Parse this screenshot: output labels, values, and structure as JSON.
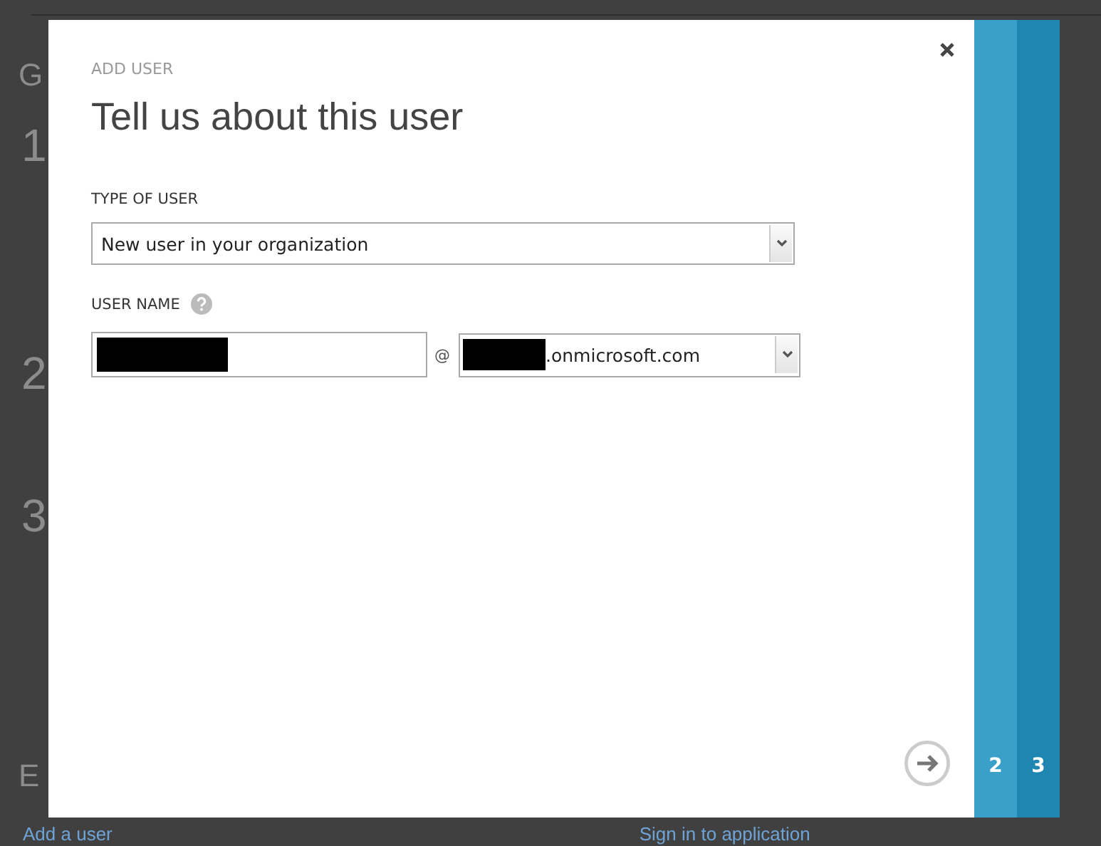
{
  "background": {
    "heading": "G",
    "steps": [
      "1",
      "2",
      "3"
    ],
    "section": "E",
    "links": [
      "Add a user",
      "Sign in to application"
    ]
  },
  "dialog": {
    "caption": "ADD USER",
    "title": "Tell us about this user",
    "type_label": "TYPE OF USER",
    "type_value": "New user in your organization",
    "username_label": "USER NAME",
    "username": {
      "redacted": true
    },
    "at": "@",
    "domain": {
      "redacted": true,
      "suffix": ".onmicrosoft.com"
    }
  },
  "wizard_steps": [
    {
      "label": "2",
      "color": "#3a9fc9"
    },
    {
      "label": "3",
      "color": "#1e86b1"
    }
  ]
}
